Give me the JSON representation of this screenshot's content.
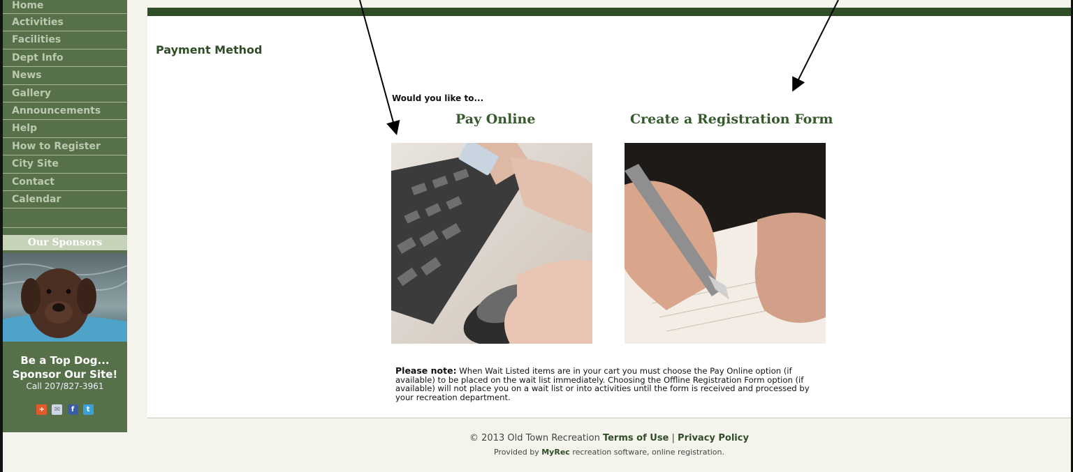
{
  "nav": {
    "items": [
      {
        "label": "Home"
      },
      {
        "label": "Activities"
      },
      {
        "label": "Facilities"
      },
      {
        "label": "Dept Info"
      },
      {
        "label": "News"
      },
      {
        "label": "Gallery"
      },
      {
        "label": "Announcements"
      },
      {
        "label": "Help"
      },
      {
        "label": "How to Register"
      },
      {
        "label": "City Site"
      },
      {
        "label": "Contact"
      },
      {
        "label": "Calendar"
      }
    ]
  },
  "sponsors": {
    "heading": "Our Sponsors",
    "line1": "Be a Top Dog...",
    "line2": "Sponsor Our Site!",
    "line3": "Call 207/827-3961",
    "social_icons": [
      "add-icon",
      "mail-icon",
      "facebook-icon",
      "twitter-icon"
    ]
  },
  "main": {
    "title": "Payment Method",
    "ask": "Would you like to...",
    "option_online": "Pay Online",
    "option_form": "Create a Registration Form",
    "note_label": "Please note:",
    "note_text": " When Wait Listed items are in your cart you must choose the Pay Online option (if available) to be placed on the wait list immediately. Choosing the Offline Registration Form option (if available) will not place you on a wait list or into activities until the form is received and processed by your recreation department."
  },
  "footer": {
    "copyright": "© 2013 Old Town Recreation",
    "terms": "Terms of Use",
    "separator": "|",
    "privacy": "Privacy Policy",
    "provided_prefix": "Provided by",
    "provider": "MyRec",
    "provided_suffix": "recreation software, online registration."
  },
  "colors": {
    "sidebar": "#56704a",
    "accent": "#2f4d27",
    "title": "#355a2b"
  }
}
